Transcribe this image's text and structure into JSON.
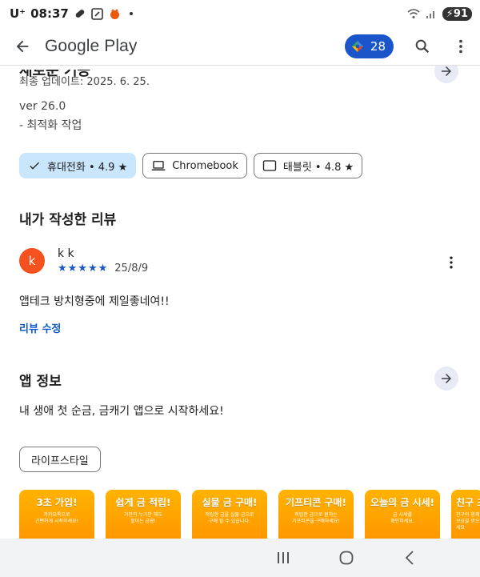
{
  "status_bar": {
    "carrier": "U⁺",
    "time": "08:37",
    "battery": "91"
  },
  "app_bar": {
    "title": "Google Play",
    "points": "28"
  },
  "update": {
    "heading": "새로운 기능",
    "last_updated": "최종 업데이트: 2025. 6. 25.",
    "version": "ver 26.0",
    "note": "- 최적화 작업"
  },
  "device_chips": [
    {
      "label": "휴대전화 • 4.9 ★",
      "selected": true
    },
    {
      "label": "Chromebook",
      "selected": false
    },
    {
      "label": "태블릿 • 4.8 ★",
      "selected": false
    }
  ],
  "my_review": {
    "title": "내가 작성한 리뷰",
    "avatar_letter": "k",
    "name": "k k",
    "stars": "★★★★★",
    "date": "25/8/9",
    "text": "앱테크 방치형중에 제일좋네여!!",
    "edit_label": "리뷰 수정"
  },
  "app_info": {
    "title": "앱 정보",
    "description": "내 생애 첫 순금, 금캐기 앱으로 시작하세요!",
    "category": "라이프스타일"
  },
  "screenshots": [
    {
      "title": "3초 가입!",
      "sub": "카카오톡으로\n간편하게 시작하세요!"
    },
    {
      "title": "쉽게 금 적립!",
      "sub": "가만히 누기만 해도\n쌓이는 금광!"
    },
    {
      "title": "실물 금 구매!",
      "sub": "적립한 금을 실물 금으로\n구매 할 수 있습니다."
    },
    {
      "title": "기프티콘 구매!",
      "sub": "적립한 금으로 원하는\n기프티콘을 구매하세요!"
    },
    {
      "title": "오늘의 금 시세!",
      "sub": "금 시세를\n확인하세요."
    },
    {
      "title": "친구 초대!",
      "sub": "친구와 함께\n보상을 받으세요"
    }
  ],
  "colors": {
    "accent": "#1a56c9",
    "chip_selected": "#c9e6fc",
    "avatar": "#f4511e",
    "link": "#0b57d0"
  }
}
